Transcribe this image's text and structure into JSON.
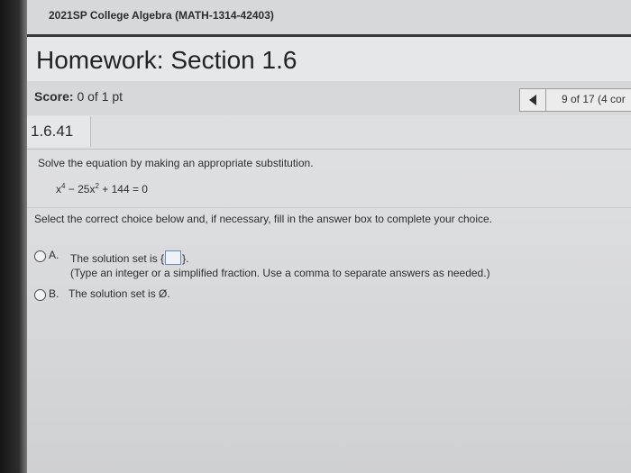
{
  "course": {
    "title": "2021SP College Algebra (MATH-1314-42403)"
  },
  "header": {
    "title": "Homework: Section 1.6"
  },
  "score": {
    "label": "Score:",
    "value": "0 of 1 pt"
  },
  "nav": {
    "count": "9 of 17 (4 cor"
  },
  "question": {
    "id": "1.6.41",
    "instruction": "Solve the equation by making an appropriate substitution.",
    "equation": {
      "part1": "x",
      "exp1": "4",
      "part2": " − 25x",
      "exp2": "2",
      "part3": " + 144 = 0"
    },
    "prompt": "Select the correct choice below and, if necessary, fill in the answer box to complete your choice."
  },
  "choices": {
    "a": {
      "letter": "A.",
      "text_before": "The solution set is {",
      "text_after": "}.",
      "hint": "(Type an integer or a simplified fraction. Use a comma to separate answers as needed.)"
    },
    "b": {
      "letter": "B.",
      "text": "The solution set is Ø."
    }
  }
}
